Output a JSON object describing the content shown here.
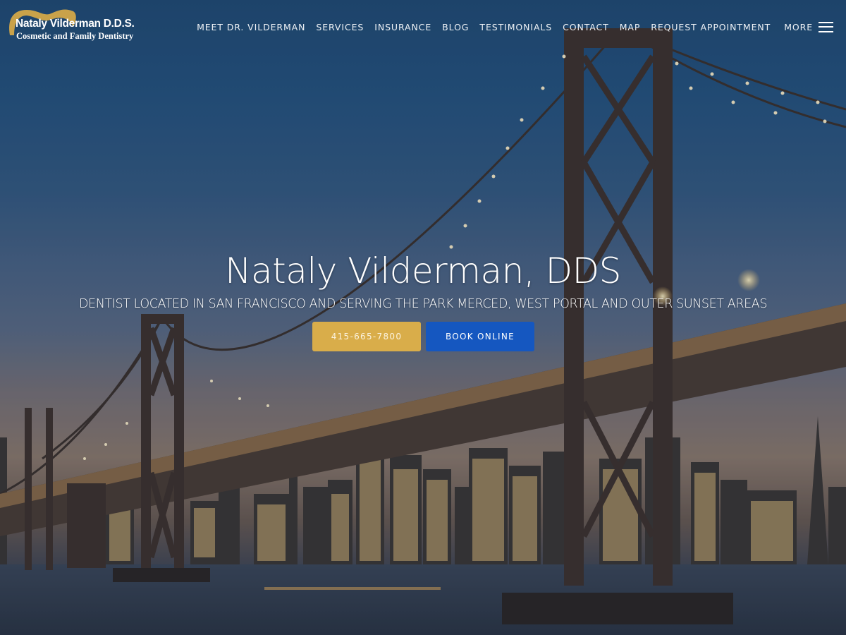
{
  "logo": {
    "title": "Nataly Vilderman D.D.S.",
    "subtitle": "Cosmetic and Family Dentistry",
    "icon": "tooth-arc-icon",
    "accent_color": "#c9a24a"
  },
  "nav": {
    "items": [
      {
        "label": "MEET DR. VILDERMAN"
      },
      {
        "label": "SERVICES"
      },
      {
        "label": "INSURANCE"
      },
      {
        "label": "BLOG"
      },
      {
        "label": "TESTIMONIALS"
      },
      {
        "label": "CONTACT"
      },
      {
        "label": "MAP"
      },
      {
        "label": "REQUEST APPOINTMENT"
      }
    ],
    "more_label": "MORE",
    "menu_icon": "hamburger-menu-icon"
  },
  "hero": {
    "headline": "Nataly Vilderman, DDS",
    "subline": "DENTIST LOCATED IN SAN FRANCISCO AND SERVING THE PARK MERCED, WEST PORTAL AND OUTER SUNSET AREAS",
    "background": "bay-bridge-san-francisco-skyline-photo",
    "buttons": {
      "phone_label": "415-665-7800",
      "phone_color": "#d9ad4a",
      "book_label": "BOOK ONLINE",
      "book_color": "#1557c0"
    }
  }
}
